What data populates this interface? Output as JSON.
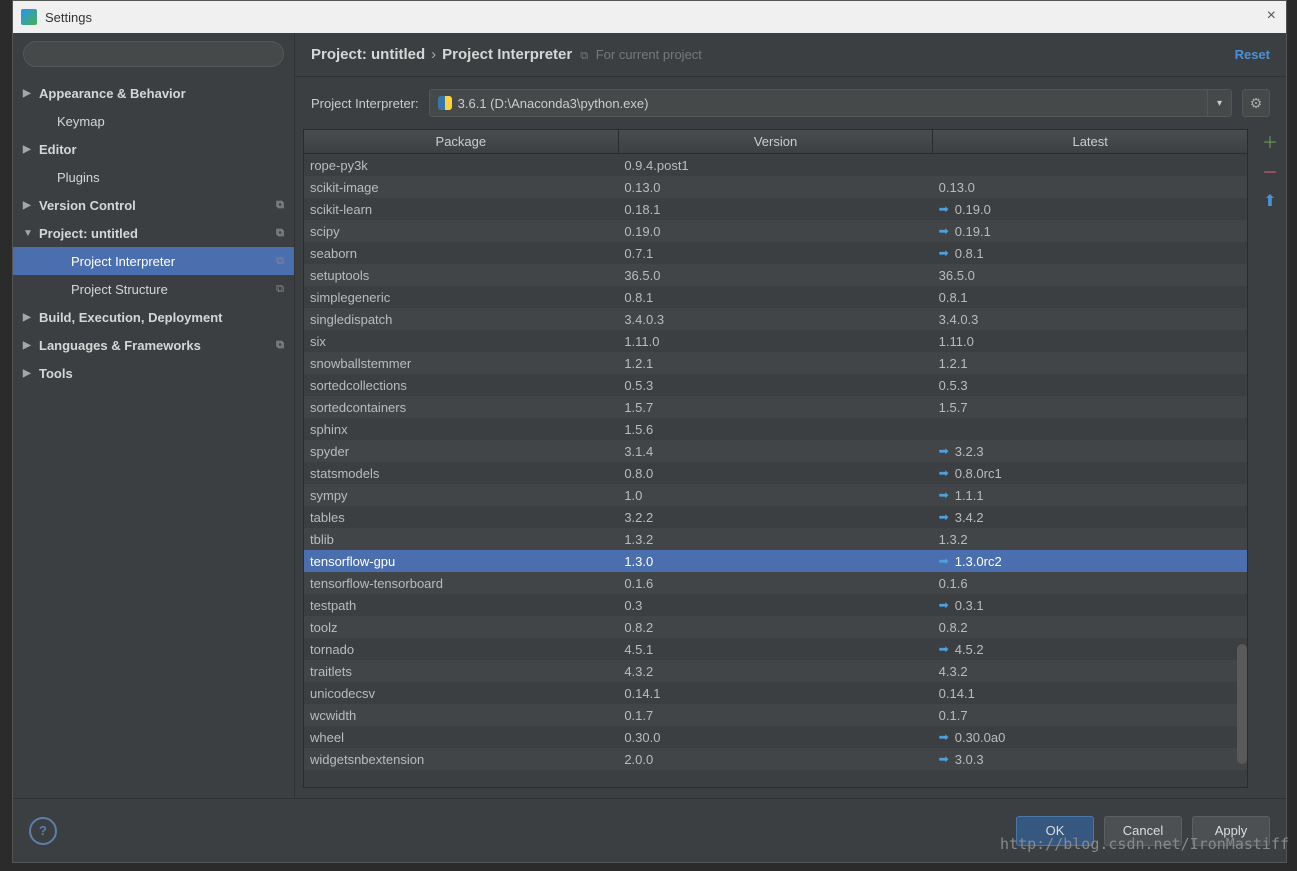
{
  "window": {
    "title": "Settings"
  },
  "breadcrumb": {
    "project": "Project: untitled",
    "page": "Project Interpreter",
    "hint": "For current project",
    "reset": "Reset"
  },
  "interpreter": {
    "label": "Project Interpreter:",
    "value": "3.6.1 (D:\\Anaconda3\\python.exe)"
  },
  "sidebar": {
    "items": [
      {
        "label": "Appearance & Behavior",
        "expandable": true
      },
      {
        "label": "Keymap",
        "child": true
      },
      {
        "label": "Editor",
        "expandable": true
      },
      {
        "label": "Plugins",
        "child": true
      },
      {
        "label": "Version Control",
        "expandable": true,
        "copy": true
      },
      {
        "label": "Project: untitled",
        "expandable": true,
        "expanded": true,
        "copy": true
      },
      {
        "label": "Project Interpreter",
        "child2": true,
        "selected": true,
        "copy": true
      },
      {
        "label": "Project Structure",
        "child2": true,
        "copy": true
      },
      {
        "label": "Build, Execution, Deployment",
        "expandable": true
      },
      {
        "label": "Languages & Frameworks",
        "expandable": true,
        "copy": true
      },
      {
        "label": "Tools",
        "expandable": true
      }
    ]
  },
  "table": {
    "headers": {
      "package": "Package",
      "version": "Version",
      "latest": "Latest"
    },
    "rows": [
      {
        "pkg": "rope-py3k",
        "ver": "0.9.4.post1",
        "latest": "",
        "upd": false
      },
      {
        "pkg": "scikit-image",
        "ver": "0.13.0",
        "latest": "0.13.0",
        "upd": false
      },
      {
        "pkg": "scikit-learn",
        "ver": "0.18.1",
        "latest": "0.19.0",
        "upd": true
      },
      {
        "pkg": "scipy",
        "ver": "0.19.0",
        "latest": "0.19.1",
        "upd": true
      },
      {
        "pkg": "seaborn",
        "ver": "0.7.1",
        "latest": "0.8.1",
        "upd": true
      },
      {
        "pkg": "setuptools",
        "ver": "36.5.0",
        "latest": "36.5.0",
        "upd": false
      },
      {
        "pkg": "simplegeneric",
        "ver": "0.8.1",
        "latest": "0.8.1",
        "upd": false
      },
      {
        "pkg": "singledispatch",
        "ver": "3.4.0.3",
        "latest": "3.4.0.3",
        "upd": false
      },
      {
        "pkg": "six",
        "ver": "1.11.0",
        "latest": "1.11.0",
        "upd": false
      },
      {
        "pkg": "snowballstemmer",
        "ver": "1.2.1",
        "latest": "1.2.1",
        "upd": false
      },
      {
        "pkg": "sortedcollections",
        "ver": "0.5.3",
        "latest": "0.5.3",
        "upd": false
      },
      {
        "pkg": "sortedcontainers",
        "ver": "1.5.7",
        "latest": "1.5.7",
        "upd": false
      },
      {
        "pkg": "sphinx",
        "ver": "1.5.6",
        "latest": "",
        "upd": false
      },
      {
        "pkg": "spyder",
        "ver": "3.1.4",
        "latest": "3.2.3",
        "upd": true
      },
      {
        "pkg": "statsmodels",
        "ver": "0.8.0",
        "latest": "0.8.0rc1",
        "upd": true
      },
      {
        "pkg": "sympy",
        "ver": "1.0",
        "latest": "1.1.1",
        "upd": true
      },
      {
        "pkg": "tables",
        "ver": "3.2.2",
        "latest": "3.4.2",
        "upd": true
      },
      {
        "pkg": "tblib",
        "ver": "1.3.2",
        "latest": "1.3.2",
        "upd": false
      },
      {
        "pkg": "tensorflow-gpu",
        "ver": "1.3.0",
        "latest": "1.3.0rc2",
        "upd": true,
        "selected": true
      },
      {
        "pkg": "tensorflow-tensorboard",
        "ver": "0.1.6",
        "latest": "0.1.6",
        "upd": false
      },
      {
        "pkg": "testpath",
        "ver": "0.3",
        "latest": "0.3.1",
        "upd": true
      },
      {
        "pkg": "toolz",
        "ver": "0.8.2",
        "latest": "0.8.2",
        "upd": false
      },
      {
        "pkg": "tornado",
        "ver": "4.5.1",
        "latest": "4.5.2",
        "upd": true
      },
      {
        "pkg": "traitlets",
        "ver": "4.3.2",
        "latest": "4.3.2",
        "upd": false
      },
      {
        "pkg": "unicodecsv",
        "ver": "0.14.1",
        "latest": "0.14.1",
        "upd": false
      },
      {
        "pkg": "wcwidth",
        "ver": "0.1.7",
        "latest": "0.1.7",
        "upd": false
      },
      {
        "pkg": "wheel",
        "ver": "0.30.0",
        "latest": "0.30.0a0",
        "upd": true
      },
      {
        "pkg": "widgetsnbextension",
        "ver": "2.0.0",
        "latest": "3.0.3",
        "upd": true
      }
    ]
  },
  "footer": {
    "ok": "OK",
    "cancel": "Cancel",
    "apply": "Apply"
  },
  "watermark": "http://blog.csdn.net/IronMastiff"
}
